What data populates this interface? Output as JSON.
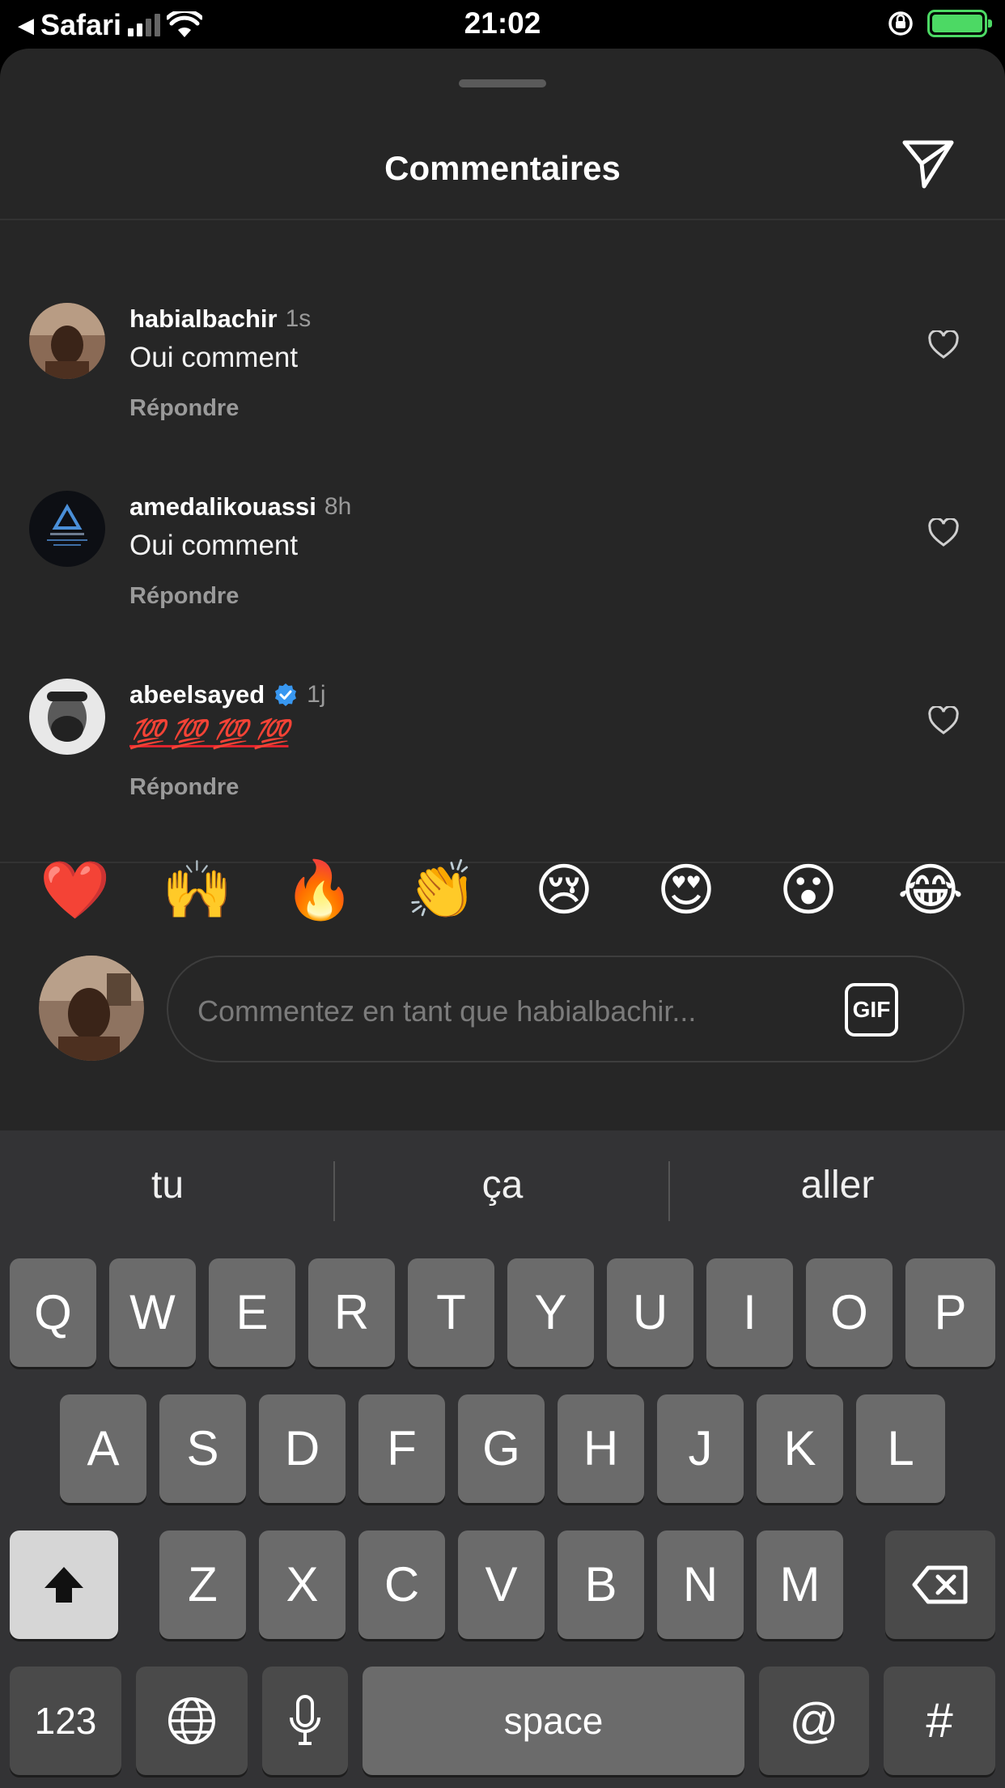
{
  "status_bar": {
    "back_app": "Safari",
    "time": "21:02"
  },
  "sheet": {
    "title": "Commentaires"
  },
  "comments": [
    {
      "username": "habialbachir",
      "time": "1s",
      "text": "Oui comment",
      "reply": "Répondre",
      "verified": false
    },
    {
      "username": "amedalikouassi",
      "time": "8h",
      "text": "Oui comment",
      "reply": "Répondre",
      "verified": false
    },
    {
      "username": "abeelsayed",
      "time": "1j",
      "text": "💯 💯 💯 💯",
      "reply": "Répondre",
      "verified": true
    }
  ],
  "reactions": [
    "❤️",
    "🙌",
    "🔥",
    "👏",
    "😢",
    "😍",
    "😮",
    "😂"
  ],
  "composer": {
    "placeholder": "Commentez en tant que habialbachir...",
    "gif_label": "GIF"
  },
  "keyboard": {
    "suggestions": [
      "tu",
      "ça",
      "aller"
    ],
    "row1": [
      "Q",
      "W",
      "E",
      "R",
      "T",
      "Y",
      "U",
      "I",
      "O",
      "P"
    ],
    "row2": [
      "A",
      "S",
      "D",
      "F",
      "G",
      "H",
      "J",
      "K",
      "L"
    ],
    "row3": [
      "Z",
      "X",
      "C",
      "V",
      "B",
      "N",
      "M"
    ],
    "numbers_label": "123",
    "space_label": "space",
    "at_label": "@",
    "hash_label": "#"
  },
  "colors": {
    "sheet_bg": "#262626",
    "keyboard_bg": "#333335",
    "key_bg": "#6b6b6b",
    "verified": "#3897f0",
    "battery": "#4cd964"
  }
}
